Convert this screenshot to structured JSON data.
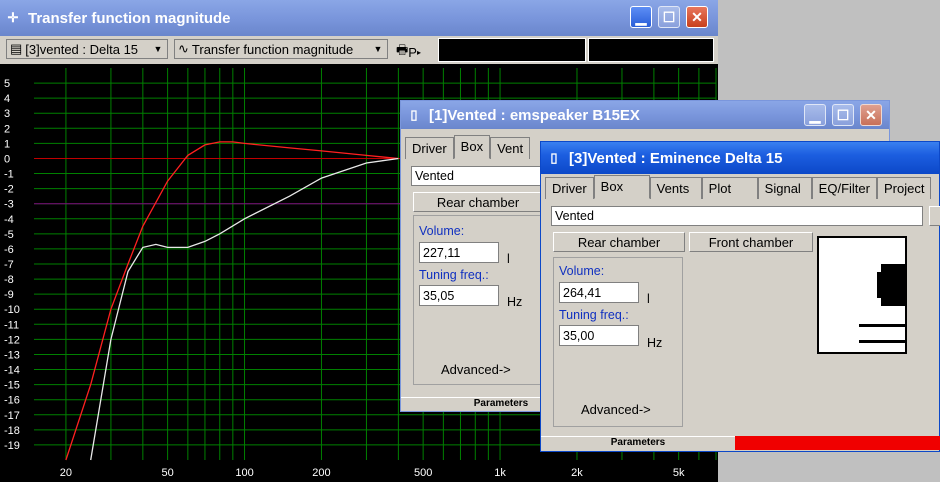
{
  "main_window": {
    "title": "Transfer function magnitude",
    "selector_label": "[3]vented : Delta 15",
    "plot_selector_label": "Transfer function magnitude",
    "print_label": "P"
  },
  "chart_data": {
    "type": "line",
    "x_scale": "log",
    "xlim": [
      15,
      7000
    ],
    "ylim": [
      -20,
      6
    ],
    "y_ticks": [
      "5",
      "4",
      "3",
      "2",
      "1",
      "0",
      "-1",
      "-2",
      "-3",
      "-4",
      "-5",
      "-6",
      "-7",
      "-8",
      "-9",
      "-10",
      "-11",
      "-12",
      "-13",
      "-14",
      "-15",
      "-16",
      "-17",
      "-18",
      "-19"
    ],
    "x_tick_labels": [
      "20",
      "50",
      "100",
      "200",
      "500",
      "1k",
      "2k",
      "5k"
    ],
    "x_tick_values": [
      20,
      50,
      100,
      200,
      500,
      1000,
      2000,
      5000
    ],
    "grid": true,
    "reference_lines": [
      {
        "y": 0,
        "color": "#c00000"
      },
      {
        "y": -3,
        "color": "#800080"
      }
    ],
    "series": [
      {
        "color": "#ff2020",
        "x": [
          20,
          25,
          30,
          35,
          40,
          50,
          60,
          70,
          80,
          90,
          100,
          150,
          200,
          300,
          400
        ],
        "y": [
          -20,
          -15,
          -10,
          -7,
          -4.5,
          -1.5,
          0.2,
          0.9,
          1.1,
          1.1,
          1.0,
          0.7,
          0.5,
          0.2,
          0
        ]
      },
      {
        "color": "#e8e8e8",
        "x": [
          25,
          30,
          35,
          40,
          45,
          50,
          60,
          70,
          80,
          100,
          150,
          200,
          300,
          400
        ],
        "y": [
          -20,
          -12,
          -7.5,
          -5.9,
          -5.7,
          -5.9,
          -5.9,
          -5.5,
          -5,
          -4,
          -2.5,
          -1.3,
          -0.3,
          0
        ]
      }
    ]
  },
  "window1": {
    "title": "[1]Vented : emspeaker B15EX",
    "tabs": [
      "Driver",
      "Box",
      "Vent"
    ],
    "box_type": "Vented",
    "rear_chamber_label": "Rear chamber",
    "volume_label": "Volume:",
    "volume_value": "227,11",
    "volume_unit": "l",
    "tuning_label": "Tuning freq.:",
    "tuning_value": "35,05",
    "tuning_unit": "Hz",
    "advanced_label": "Advanced->",
    "status": "Parameters"
  },
  "window3": {
    "title": "[3]Vented : Eminence  Delta 15",
    "tabs": [
      "Driver",
      "Box",
      "Vents",
      "Plot",
      "Signal",
      "EQ/Filter",
      "Project"
    ],
    "box_type": "Vented",
    "rear_chamber_label": "Rear chamber",
    "front_chamber_label": "Front chamber",
    "volume_label": "Volume:",
    "volume_value": "264,41",
    "volume_unit": "l",
    "tuning_label": "Tuning freq.:",
    "tuning_value": "35,00",
    "tuning_unit": "Hz",
    "advanced_label": "Advanced->",
    "status": "Parameters"
  }
}
